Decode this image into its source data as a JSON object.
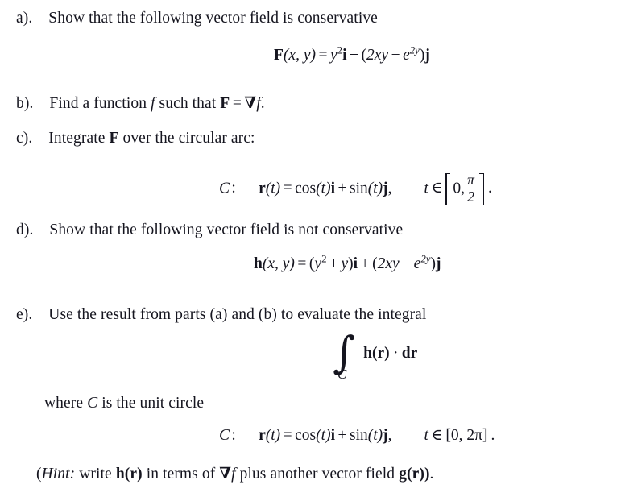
{
  "document": {
    "type": "math-problem-set",
    "text_color": "#15151f",
    "background_color": "#ffffff",
    "parts": [
      {
        "id": "a",
        "label": "a).",
        "prompt": "Show that the following vector field is conservative",
        "equation_plain": "F(x, y) = y²i + (2xy − e^{2y})j",
        "equation_parts": {
          "lhs_vector": "F",
          "lhs_args": "(x, y)",
          "equals": "=",
          "term1_base": "y",
          "term1_exp": "2",
          "term1_unit": "i",
          "plus": "+",
          "group_open": "(",
          "term2_a": "2xy",
          "minus": "−",
          "term2_b_base": "e",
          "term2_b_exp": "2y",
          "group_close": ")",
          "term2_unit": "j"
        }
      },
      {
        "id": "b",
        "label": "b).",
        "prompt_pre": "Find a function",
        "prompt_var": "f",
        "prompt_mid": "such that",
        "prompt_eq_lhs": "F",
        "prompt_eq_sign": "=",
        "prompt_eq_nabla": "∇",
        "prompt_eq_f": "f",
        "prompt_end": ".",
        "prompt_plain": "Find a function f such that F = ∇f."
      },
      {
        "id": "c",
        "label": "c).",
        "prompt_pre": "Integrate",
        "prompt_vec": "F",
        "prompt_post": "over the circular arc:",
        "prompt_plain": "Integrate F over the circular arc:",
        "curve": {
          "name": "C",
          "colon": ":",
          "r_symbol": "r",
          "r_arg": "(t)",
          "equals": "=",
          "cos": "cos",
          "cos_arg": "(t)",
          "unit_i": "i",
          "plus": "+",
          "sin": "sin",
          "sin_arg": "(t)",
          "unit_j": "j",
          "comma": ",",
          "domain_var": "t",
          "domain_in": "∈",
          "interval_open": "[",
          "interval_lo": "0,",
          "frac_num": "π",
          "frac_den": "2",
          "interval_close": "]",
          "period": ".",
          "interval_plain": "[0, π/2]"
        }
      },
      {
        "id": "d",
        "label": "d).",
        "prompt": "Show that the following vector field is not conservative",
        "equation_plain": "h(x, y) = (y² + y)i + (2xy − e^{2y})j",
        "equation_parts": {
          "lhs_vector": "h",
          "lhs_args": "(x, y)",
          "equals": "=",
          "g1_open": "(",
          "g1_base": "y",
          "g1_exp": "2",
          "g1_plus": "+",
          "g1_y": "y",
          "g1_close": ")",
          "unit_i": "i",
          "plus": "+",
          "g2_open": "(",
          "g2_a": "2xy",
          "minus": "−",
          "g2_b_base": "e",
          "g2_b_exp": "2y",
          "g2_close": ")",
          "unit_j": "j"
        }
      },
      {
        "id": "e",
        "label": "e).",
        "prompt": "Use the result from parts (a) and (b) to evaluate the integral",
        "integral": {
          "symbol": "∫",
          "subscript": "C",
          "integrand_vec": "h",
          "integrand_arg": "(r)",
          "dot": "·",
          "differential": "dr",
          "plain": "∫_C h(r) · dr"
        },
        "where_pre": "where",
        "where_var": "C",
        "where_post": "is the unit circle",
        "where_plain": "where C is the unit circle",
        "curve": {
          "name": "C",
          "colon": ":",
          "r_symbol": "r",
          "r_arg": "(t)",
          "equals": "=",
          "cos": "cos",
          "cos_arg": "(t)",
          "unit_i": "i",
          "plus": "+",
          "sin": "sin",
          "sin_arg": "(t)",
          "unit_j": "j",
          "comma": ",",
          "domain_var": "t",
          "domain_in": "∈",
          "interval": "[0, 2π]",
          "period": ".",
          "interval_plain": "[0, 2π]"
        },
        "hint": {
          "open_paren": "(",
          "word": "Hint:",
          "text_pre": "write",
          "h_vec": "h",
          "h_arg": "(r)",
          "text_mid": "in terms of",
          "nabla": "∇",
          "f_var": "f",
          "text_post": "plus another vector field",
          "g_vec": "g",
          "g_arg": "(r))",
          "period": ".",
          "plain": "(Hint: write h(r) in terms of ∇f plus another vector field g(r))."
        }
      }
    ]
  }
}
